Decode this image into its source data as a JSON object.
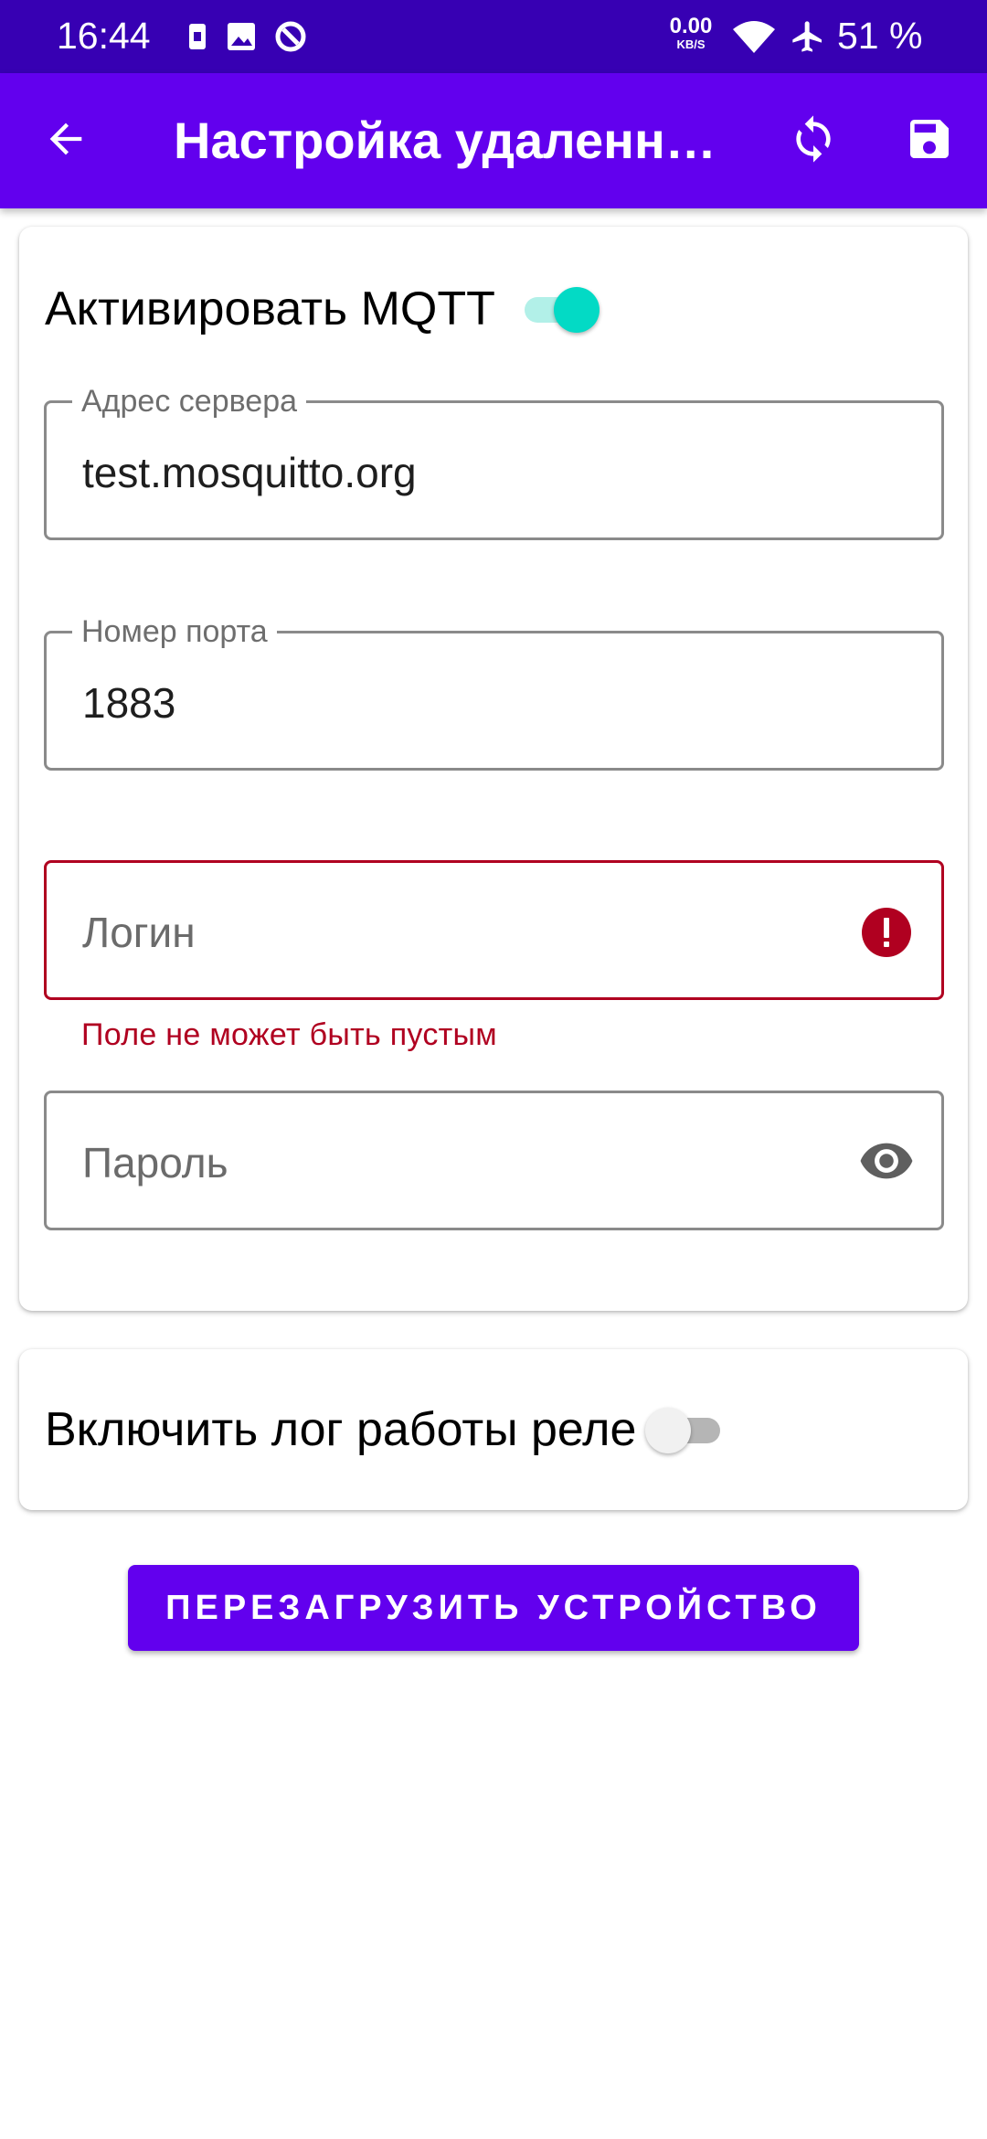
{
  "status_bar": {
    "time": "16:44",
    "net_speed_value": "0.00",
    "net_speed_unit": "KB/S",
    "battery": "51 %",
    "icons": [
      "sim-card-icon",
      "image-icon",
      "data-saver-icon",
      "wifi-icon",
      "airplane-icon"
    ]
  },
  "app_bar": {
    "title": "Настройка удаленного доступа",
    "back_icon": "arrow-back-icon",
    "sync_icon": "sync-icon",
    "save_icon": "save-icon",
    "color": "#6200ee"
  },
  "mqtt_card": {
    "toggle_label": "Активировать MQTT",
    "toggle_on": true,
    "server": {
      "label": "Адрес сервера",
      "value": "test.mosquitto.org"
    },
    "port": {
      "label": "Номер порта",
      "value": "1883"
    },
    "login": {
      "placeholder": "Логин",
      "value": "",
      "error": "Поле не может быть пустым",
      "error_icon": "error-icon"
    },
    "password": {
      "placeholder": "Пароль",
      "value": "",
      "trailing_icon": "eye-icon"
    }
  },
  "log_card": {
    "toggle_label": "Включить лог работы реле",
    "toggle_on": false
  },
  "restart_button": {
    "label": "ПЕРЕЗАГРУЗИТЬ УСТРОЙСТВО"
  },
  "colors": {
    "status_bar": "#3700b3",
    "primary": "#6200ee",
    "switch_on": "#03dac5",
    "error": "#b00020"
  }
}
